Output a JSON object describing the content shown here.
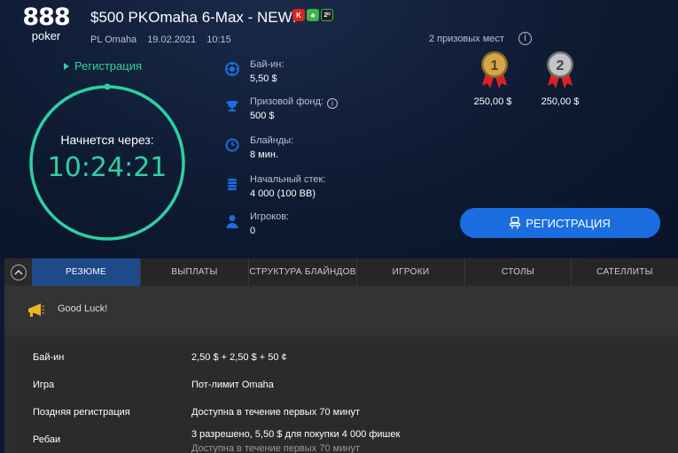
{
  "logo": {
    "top": "888",
    "bottom": "poker"
  },
  "header": {
    "title": "$500 PKOmaha 6-Max - NEW!",
    "badges": [
      "K",
      "♣",
      "2ᴴ"
    ],
    "game": "PL Omaha",
    "date": "19.02.2021",
    "time": "10:15"
  },
  "status": {
    "label": "Регистрация",
    "starts_in_label": "Начнется через:",
    "countdown": "10:24:21"
  },
  "info": {
    "buyin": {
      "label": "Бай-ин:",
      "value": "5,50 $"
    },
    "prize": {
      "label": "Призовой фонд:",
      "value": "500 $"
    },
    "blinds": {
      "label": "Блайнды:",
      "value": "8 мин."
    },
    "stack": {
      "label": "Начальный стек:",
      "value": "4 000 (100 BB)"
    },
    "players": {
      "label": "Игроков:",
      "value": "0"
    }
  },
  "prizes": {
    "header": "2 призовых мест",
    "places": [
      {
        "place": "1",
        "amount": "250,00 $"
      },
      {
        "place": "2",
        "amount": "250,00 $"
      }
    ]
  },
  "register_button": "РЕГИСТРАЦИЯ",
  "tabs": [
    "РЕЗЮМЕ",
    "ВЫПЛАТЫ",
    "СТРУКТУРА БЛАЙНДОВ",
    "ИГРОКИ",
    "СТОЛЫ",
    "САТЕЛЛИТЫ"
  ],
  "message": "Good Luck!",
  "details": [
    {
      "key": "Бай-ин",
      "value": "2,50 $ + 2,50 $ + 50 ¢"
    },
    {
      "key": "Игра",
      "value": "Пот-лимит Omaha"
    },
    {
      "key": "Поздняя регистрация",
      "value": "Доступна в течение первых 70 минут"
    },
    {
      "key": "Ребаи",
      "value": "3 разрешено, 5,50 $ для покупки 4 000 фишек",
      "value2": "Доступна в течение первых 70 минут"
    }
  ],
  "colors": {
    "accent": "#2ed1a2",
    "button": "#1a6ee0",
    "active_tab": "#1e4a8a",
    "gold": "#d4a84a",
    "silver": "#b8b8b8"
  }
}
